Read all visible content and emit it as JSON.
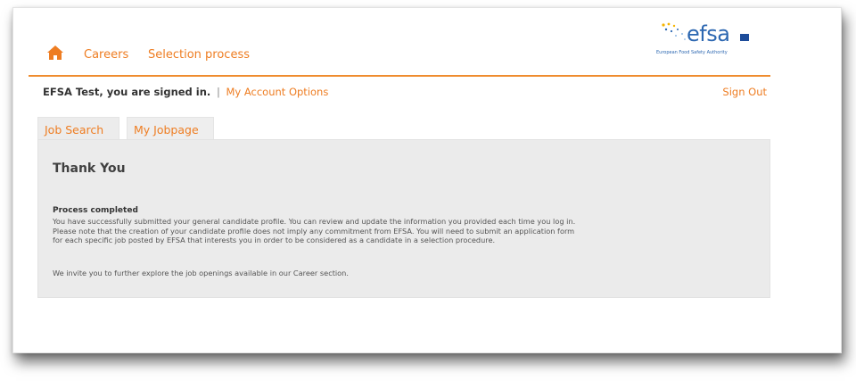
{
  "nav": {
    "careers": "Careers",
    "selection_process": "Selection process"
  },
  "logo": {
    "name": "efsa",
    "subtitle": "European Food Safety Authority"
  },
  "account": {
    "signed_in": "EFSA Test, you are signed in.",
    "separator": "|",
    "options": "My Account Options",
    "sign_out": "Sign Out"
  },
  "tabs": [
    {
      "label": "Job Search"
    },
    {
      "label": "My Jobpage"
    }
  ],
  "panel": {
    "title": "Thank You",
    "process_heading": "Process completed",
    "body_lines": [
      "You have successfully submitted your general candidate profile. You can review and update the information you provided each time you log in.",
      "Please note that the creation of your candidate profile does not imply any commitment from EFSA. You will need to submit an application form",
      "for each specific job posted by EFSA that interests you in order to be considered as a candidate in a selection procedure."
    ],
    "invite": "We invite you to further explore the job openings available in our Career section."
  },
  "colors": {
    "accent": "#ee7d22",
    "brand_blue": "#2c67b1",
    "panel_bg": "#ebebeb"
  },
  "icons": {
    "home": "home-icon",
    "logo_dots": "logo-dots-icon",
    "logo_flag": "eu-flag-icon"
  }
}
